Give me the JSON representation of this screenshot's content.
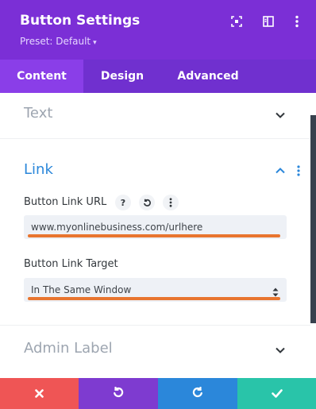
{
  "header": {
    "title": "Button Settings",
    "preset": "Preset: Default",
    "bg_color": "#7b2fd6",
    "icons": [
      "target-icon",
      "sidebar-toggle-icon",
      "more-vertical-icon"
    ]
  },
  "tabs": [
    {
      "label": "Content",
      "active": true
    },
    {
      "label": "Design",
      "active": false
    },
    {
      "label": "Advanced",
      "active": false
    }
  ],
  "sections": {
    "text": {
      "title": "Text",
      "expanded": false
    },
    "link": {
      "title": "Link",
      "expanded": true,
      "url_field": {
        "label": "Button Link URL",
        "value": "www.myonlinebusiness.com/urlhere",
        "help_icon": "help-icon",
        "reset_icon": "reset-icon",
        "more_icon": "more-vertical-icon"
      },
      "target_field": {
        "label": "Button Link Target",
        "value": "In The Same Window"
      }
    },
    "admin_label": {
      "title": "Admin Label",
      "expanded": false
    }
  },
  "footer": {
    "buttons": [
      {
        "name": "cancel",
        "icon": "close-icon",
        "color": "#ef5555"
      },
      {
        "name": "undo",
        "icon": "undo-icon",
        "color": "#7e3bd0"
      },
      {
        "name": "redo",
        "icon": "redo-icon",
        "color": "#2b87da"
      },
      {
        "name": "save",
        "icon": "check-icon",
        "color": "#29c4a9"
      }
    ]
  },
  "colors": {
    "accent": "#2b87da",
    "highlight_underline": "#e8752f"
  }
}
